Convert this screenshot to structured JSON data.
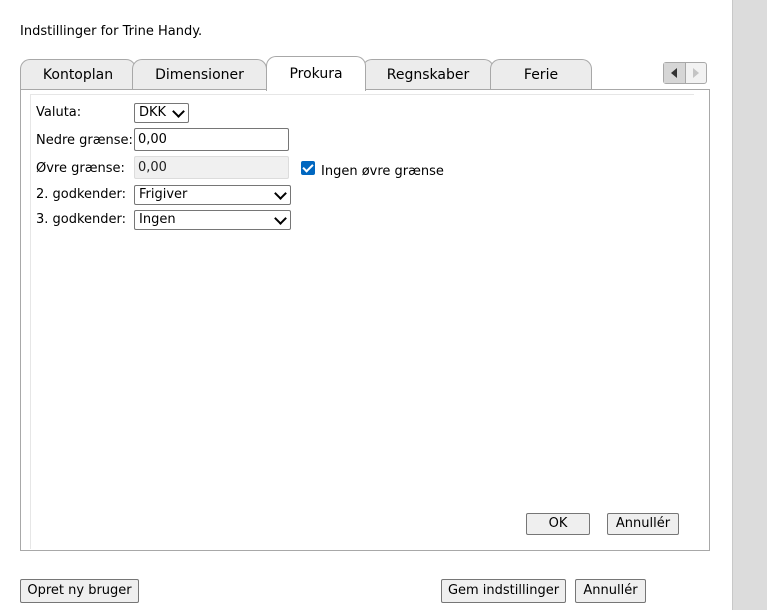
{
  "page": {
    "title": "Indstillinger for Trine Handy."
  },
  "tabs": [
    {
      "label": "Kontoplan"
    },
    {
      "label": "Dimensioner"
    },
    {
      "label": "Prokura",
      "active": true
    },
    {
      "label": "Regnskaber"
    },
    {
      "label": "Ferie"
    }
  ],
  "form": {
    "currency": {
      "label": "Valuta:",
      "value": "DKK"
    },
    "lower_limit": {
      "label": "Nedre grænse:",
      "value": "0,00"
    },
    "upper_limit": {
      "label": "Øvre grænse:",
      "value": "0,00"
    },
    "no_upper_limit": {
      "label": "Ingen øvre grænse",
      "checked": true
    },
    "approver2": {
      "label": "2. godkender:",
      "value": "Frigiver"
    },
    "approver3": {
      "label": "3. godkender:",
      "value": "Ingen"
    }
  },
  "panel_buttons": {
    "ok": "OK",
    "cancel": "Annullér"
  },
  "footer": {
    "create_user": "Opret ny bruger",
    "save_settings": "Gem indstillinger",
    "cancel": "Annullér"
  }
}
